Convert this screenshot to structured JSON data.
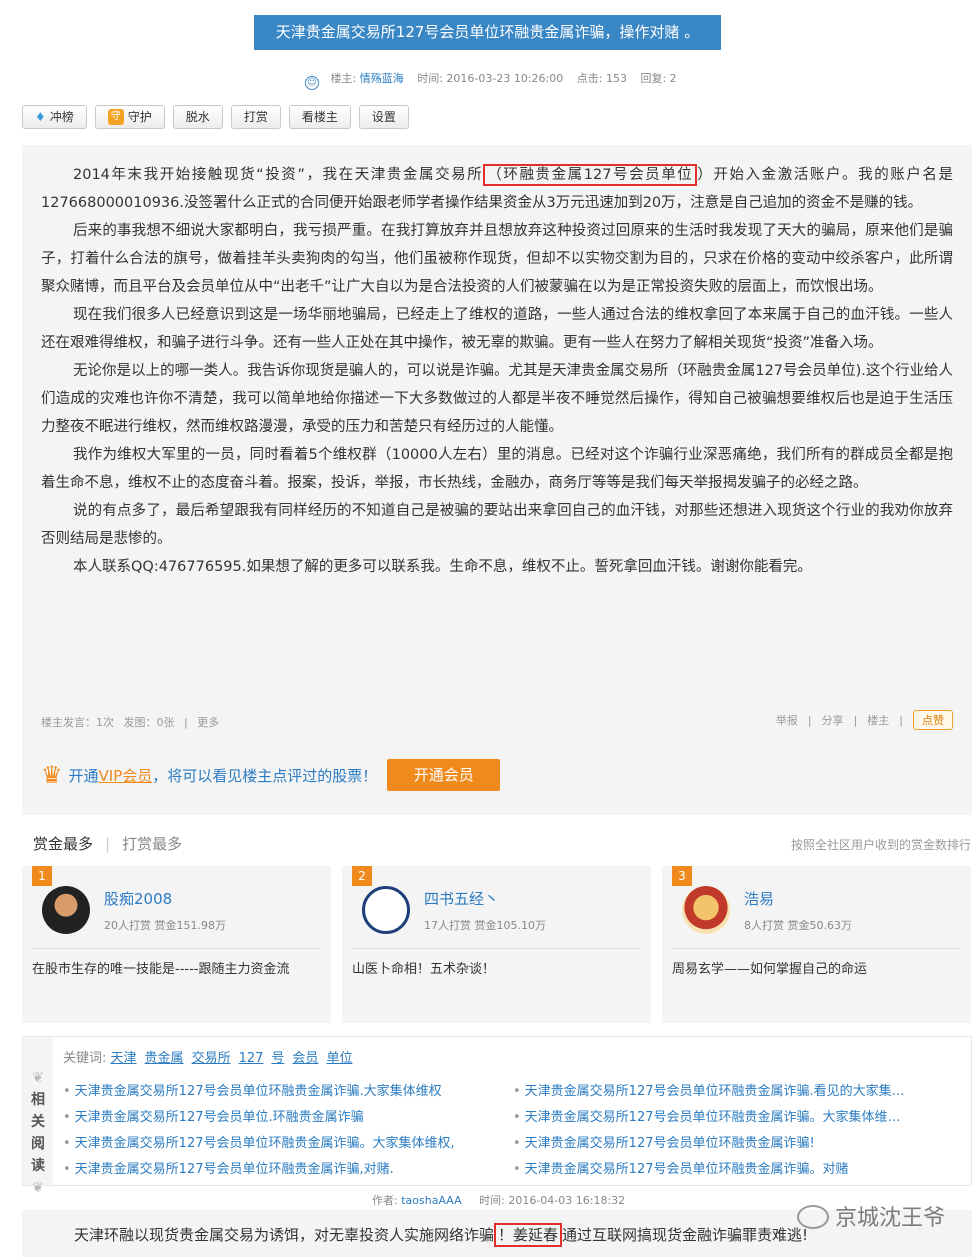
{
  "header": {
    "title": "天津贵金属交易所127号会员单位环融贵金属诈骗，操作对赌 。",
    "author_label": "楼主:",
    "author": "情殇蓝海",
    "time": "时间: 2016-03-23 10:26:00",
    "clicks": "点击: 153",
    "replies": "回复: 2"
  },
  "toolbar": {
    "buttons": [
      "冲榜",
      "守护",
      "脱水",
      "打赏",
      "看楼主",
      "设置"
    ],
    "guard_icon": "守"
  },
  "post": {
    "p1_a": "2014年末我开始接触现货“投资”，我在天津贵金属交易所",
    "p1_hl": "（环融贵金属127号会员单位",
    "p1_b": "）开始入金激活账户。我的账户名是127668000010936.没签署什么正式的合同便开始跟老师学者操作结果资金从3万元迅速加到20万，注意是自己追加的资金不是赚的钱。",
    "p2": "后来的事我想不细说大家都明白，我亏损严重。在我打算放弃并且想放弃这种投资过回原来的生活时我发现了天大的骗局，原来他们是骗子，打着什么合法的旗号，做着挂羊头卖狗肉的勾当，他们虽被称作现货，但却不以实物交割为目的，只求在价格的变动中绞杀客户，此所谓聚众赌博，而且平台及会员单位从中“出老千”让广大自以为是合法投资的人们被蒙骗在以为是正常投资失败的层面上，而饮恨出场。",
    "p3": "现在我们很多人已经意识到这是一场华丽地骗局，已经走上了维权的道路，一些人通过合法的维权拿回了本来属于自己的血汗钱。一些人还在艰难得维权，和骗子进行斗争。还有一些人正处在其中操作，被无辜的欺骗。更有一些人在努力了解相关现货“投资”准备入场。",
    "p4": "无论你是以上的哪一类人。我告诉你现货是骗人的，可以说是诈骗。尤其是天津贵金属交易所（环融贵金属127号会员单位).这个行业给人们造成的灾难也许你不清楚，我可以简单地给你描述一下大多数做过的人都是半夜不睡觉然后操作，得知自己被骗想要维权后也是迫于生活压力整夜不眠进行维权，然而维权路漫漫，承受的压力和苦楚只有经历过的人能懂。",
    "p5": "我作为维权大军里的一员，同时看着5个维权群（10000人左右）里的消息。已经对这个诈骗行业深恶痛绝，我们所有的群成员全都是抱着生命不息，维权不止的态度奋斗着。报案，投诉，举报，市长热线，金融办，商务厅等等是我们每天举报揭发骗子的必经之路。",
    "p6": "说的有点多了，最后希望跟我有同样经历的不知道自己是被骗的要站出来拿回自己的血汗钱，对那些还想进入现货这个行业的我劝你放弃否则结局是悲惨的。",
    "p7": "本人联系QQ:476776595.如果想了解的更多可以联系我。生命不息，维权不止。誓死拿回血汗钱。谢谢你能看完。"
  },
  "post_footer": {
    "posts": "楼主发言：1次",
    "images": "发图：0张",
    "more": "更多",
    "report": "举报",
    "share": "分享",
    "landlord": "楼主",
    "like": "点赞"
  },
  "vip": {
    "text_a": "开通",
    "vip": "VIP会员",
    "text_b": "，将可以看见楼主点评过的股票！",
    "button": "开通会员"
  },
  "reward": {
    "tab_active": "赏金最多",
    "tab_inactive": "打赏最多",
    "note": "按照全社区用户收到的赏金数排行",
    "cards": [
      {
        "rank": "1",
        "name": "股痴2008",
        "stats": "20人打赏 赏金151.98万",
        "desc": "在股市生存的唯一技能是-----跟随主力资金流"
      },
      {
        "rank": "2",
        "name": "四书五经丶",
        "stats": "17人打赏 赏金105.10万",
        "desc": "山医卜命相！五术杂谈！"
      },
      {
        "rank": "3",
        "name": "浩易",
        "stats": "8人打赏 赏金50.63万",
        "desc": "周易玄学——如何掌握自己的命运"
      }
    ]
  },
  "related": {
    "side_label": [
      "相",
      "关",
      "阅",
      "读"
    ],
    "keywords_label": "关键词:",
    "keywords": [
      "天津",
      "贵金属",
      "交易所",
      "127",
      "号",
      "会员",
      "单位"
    ],
    "left": [
      "天津贵金属交易所127号会员单位环融贵金属诈骗.大家集体维权",
      "天津贵金属交易所127号会员单位.环融贵金属诈骗",
      "天津贵金属交易所127号会员单位环融贵金属诈骗。大家集体维权,",
      "天津贵金属交易所127号会员单位环融贵金属诈骗,对赌."
    ],
    "right": [
      "天津贵金属交易所127号会员单位环融贵金属诈骗.看见的大家集…",
      "天津贵金属交易所127号会员单位环融贵金属诈骗。大家集体维…",
      "天津贵金属交易所127号会员单位环融贵金属诈骗!",
      "天津贵金属交易所127号会员单位环融贵金属诈骗。对赌"
    ]
  },
  "reply": {
    "author_label": "作者:",
    "author": "taoshaAAA",
    "time": "时间: 2016-04-03 16:18:32",
    "text_a": "天津环融以现货贵金属交易为诱饵，对无辜投资人实施网络诈骗",
    "text_hl": "！姜延春",
    "text_b": "通过互联网搞现货金融诈骗罪责难逃!"
  },
  "watermark": "京城沈王爷"
}
